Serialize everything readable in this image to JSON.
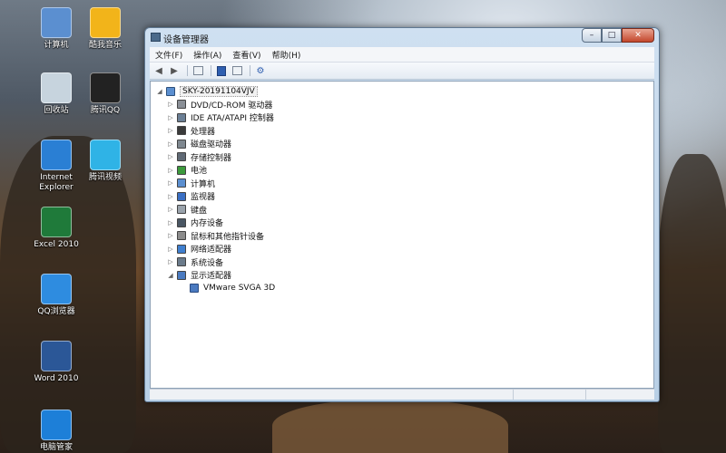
{
  "desktop": {
    "icons": [
      {
        "label": "计算机",
        "icon": "computer-icon",
        "color": "#5b8fd0"
      },
      {
        "label": "酷我音乐",
        "icon": "kuwo-music-icon",
        "color": "#f2b41a"
      },
      {
        "label": "回收站",
        "icon": "recycle-bin-icon",
        "color": "#c7d4de"
      },
      {
        "label": "腾讯QQ",
        "icon": "qq-penguin-icon",
        "color": "#222222"
      },
      {
        "label": "Internet Explorer",
        "icon": "ie-icon",
        "color": "#2a7fd4"
      },
      {
        "label": "腾讯视频",
        "icon": "tencent-video-icon",
        "color": "#2fb3e6"
      },
      {
        "label": "Excel 2010",
        "icon": "excel-icon",
        "color": "#1f7a3a"
      },
      {
        "label": "QQ浏览器",
        "icon": "qq-browser-icon",
        "color": "#2e8ce0"
      },
      {
        "label": "Word 2010",
        "icon": "word-icon",
        "color": "#2b5797"
      },
      {
        "label": "电脑管家",
        "icon": "pc-manager-icon",
        "color": "#1d7fd8"
      }
    ]
  },
  "window": {
    "title": "设备管理器",
    "buttons": {
      "minimize": "–",
      "maximize": "□",
      "close": "✕"
    }
  },
  "menu": {
    "file": "文件(F)",
    "action": "操作(A)",
    "view": "查看(V)",
    "help": "帮助(H)"
  },
  "tree": {
    "root": "SKY-20191104VJV",
    "items": [
      {
        "label": "DVD/CD-ROM 驱动器",
        "icon": "dvd-drive-icon"
      },
      {
        "label": "IDE ATA/ATAPI 控制器",
        "icon": "ide-controller-icon"
      },
      {
        "label": "处理器",
        "icon": "processor-icon"
      },
      {
        "label": "磁盘驱动器",
        "icon": "disk-drive-icon"
      },
      {
        "label": "存储控制器",
        "icon": "storage-controller-icon"
      },
      {
        "label": "电池",
        "icon": "battery-icon"
      },
      {
        "label": "计算机",
        "icon": "computer-icon"
      },
      {
        "label": "监视器",
        "icon": "monitor-icon"
      },
      {
        "label": "键盘",
        "icon": "keyboard-icon"
      },
      {
        "label": "内存设备",
        "icon": "memory-device-icon"
      },
      {
        "label": "鼠标和其他指针设备",
        "icon": "mouse-icon"
      },
      {
        "label": "网络适配器",
        "icon": "network-adapter-icon"
      },
      {
        "label": "系统设备",
        "icon": "system-device-icon"
      },
      {
        "label": "显示适配器",
        "icon": "display-adapter-icon"
      }
    ],
    "child": "VMware SVGA 3D"
  }
}
